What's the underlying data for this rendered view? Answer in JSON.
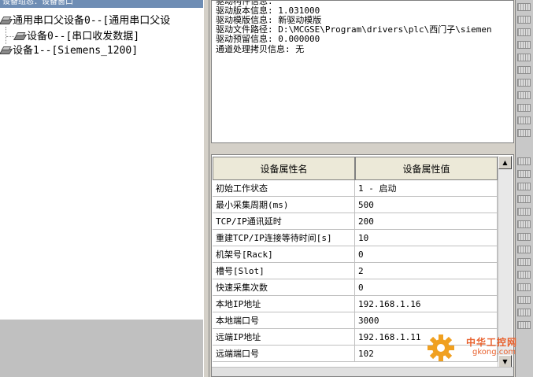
{
  "left_pane": {
    "title": "设备组态：设备窗口",
    "tree": [
      {
        "label": "通用串口父设备0--[通用串口父设",
        "level": 0
      },
      {
        "label": "设备0--[串口收发数据]",
        "level": 1
      },
      {
        "label": "设备1--[Siemens_1200]",
        "level": 0
      }
    ]
  },
  "info": {
    "lines": [
      "驱动构件信息:",
      "驱动版本信息: 1.031000",
      "驱动模版信息: 新驱动模版",
      "驱动文件路径: D:\\MCGSE\\Program\\drivers\\plc\\西门子\\siemen",
      "驱动预留信息: 0.000000",
      "通道处理拷贝信息: 无"
    ]
  },
  "grid": {
    "headers": [
      "设备属性名",
      "设备属性值"
    ],
    "rows": [
      {
        "name": "初始工作状态",
        "value": "1 - 启动"
      },
      {
        "name": "最小采集周期(ms)",
        "value": "500"
      },
      {
        "name": "TCP/IP通讯延时",
        "value": "200"
      },
      {
        "name": "重建TCP/IP连接等待时间[s]",
        "value": "10"
      },
      {
        "name": "机架号[Rack]",
        "value": "0"
      },
      {
        "name": "槽号[Slot]",
        "value": "2"
      },
      {
        "name": "快速采集次数",
        "value": "0"
      },
      {
        "name": "本地IP地址",
        "value": "192.168.1.16"
      },
      {
        "name": "本地端口号",
        "value": "3000"
      },
      {
        "name": "远端IP地址",
        "value": "192.168.1.11"
      },
      {
        "name": "远端端口号",
        "value": "102"
      }
    ],
    "scroll_up": "▲",
    "scroll_down": "▼"
  },
  "watermark": {
    "text_cn": "中华工控网",
    "text_url": "gkong.com"
  }
}
